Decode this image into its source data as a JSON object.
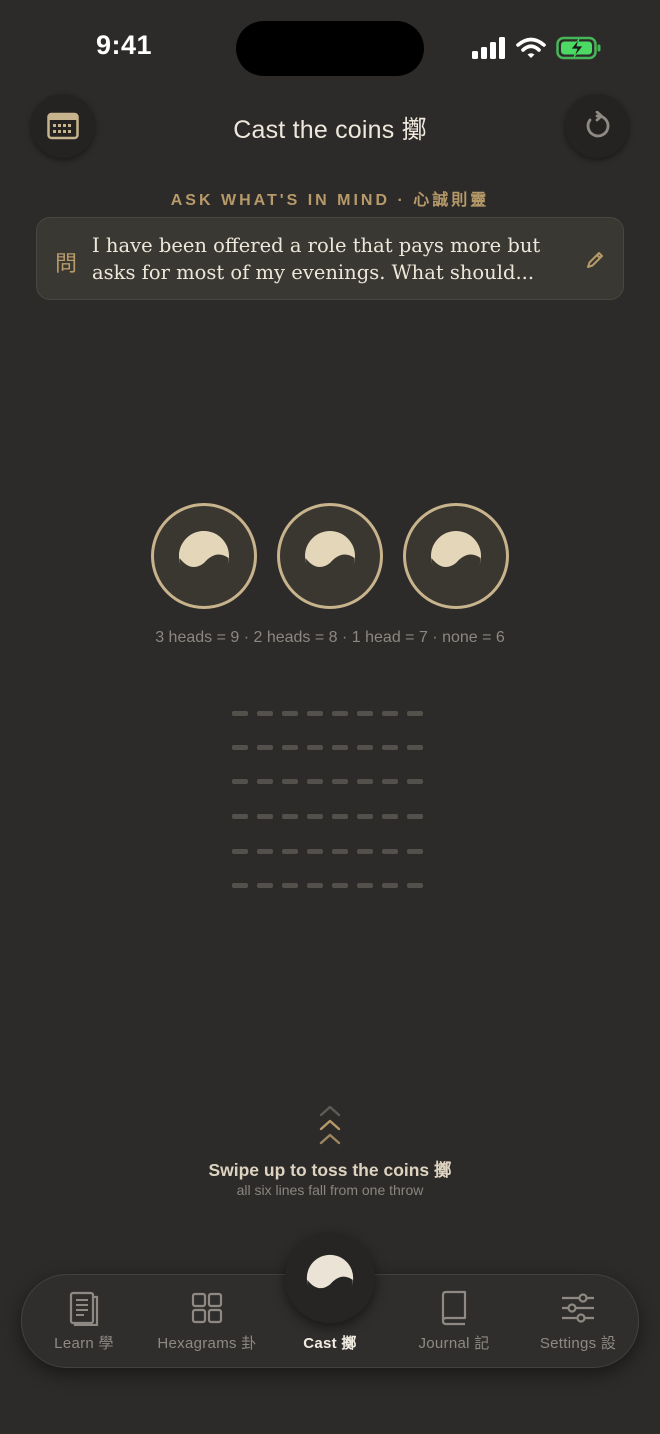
{
  "status_bar": {
    "time": "9:41",
    "icons": [
      "cellular-signal-icon",
      "wifi-icon",
      "battery-charging-icon"
    ]
  },
  "header": {
    "title": "Cast the coins 擲",
    "left_button_icon": "calendar-icon",
    "right_button_icon": "reset-icon"
  },
  "question": {
    "section_label": "ASK WHAT'S IN MIND · 心誠則靈",
    "glyph": "問",
    "text": "I have been offered a role that pays more but asks for most of my evenings. What should...",
    "edit_icon": "pencil-icon"
  },
  "coins": {
    "count": 3,
    "icon": "yin-yang-icon",
    "rule": "3 heads = 9 · 2 heads = 8 · 1 head = 7 · none = 6"
  },
  "hexagram": {
    "lines_cast": 0,
    "total_lines": 6
  },
  "swipe": {
    "icon": "chevrons-up-icon",
    "title": "Swipe up to toss the coins 擲",
    "subtitle": "all six lines fall from one throw"
  },
  "tabs": [
    {
      "label": "Learn 學",
      "icon": "book-pages-icon",
      "active": false
    },
    {
      "label": "Hexagrams 卦",
      "icon": "grid-icon",
      "active": false
    },
    {
      "label": "Cast 擲",
      "icon": "yin-yang-icon",
      "active": true
    },
    {
      "label": "Journal 記",
      "icon": "journal-book-icon",
      "active": false
    },
    {
      "label": "Settings 設",
      "icon": "sliders-icon",
      "active": false
    }
  ],
  "colors": {
    "background": "#2d2b29",
    "accent_gold": "#b79a6a",
    "coin_border": "#c8b48c",
    "coin_face": "#e4d6b8",
    "battery": "#4cd964"
  }
}
